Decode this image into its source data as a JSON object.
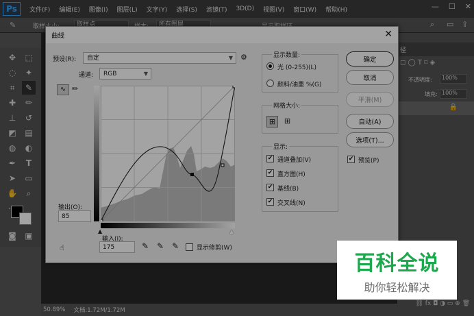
{
  "menubar": {
    "logo": "Ps",
    "items": [
      "文件(F)",
      "编辑(E)",
      "图像(I)",
      "图层(L)",
      "文字(Y)",
      "选择(S)",
      "滤镜(T)",
      "3D(D)",
      "视图(V)",
      "窗口(W)",
      "帮助(H)"
    ],
    "win_min": "—",
    "win_max": "☐",
    "win_close": "✕"
  },
  "optionsbar": {
    "sample_label": "取样大小:",
    "sample_value": "取样点",
    "layer_label": "样本:",
    "layer_value": "所有图层",
    "show_ring": "显示取样环"
  },
  "layers_panel": {
    "tab": "径",
    "opacity_label": "不透明度:",
    "opacity_value": "100%",
    "fill_label": "填充:",
    "fill_value": "100%"
  },
  "status": {
    "zoom": "50.89%",
    "doc": "文档:1.72M/1.72M"
  },
  "dialog": {
    "title": "曲线",
    "close": "✕",
    "preset_label": "预设(R):",
    "preset_value": "自定",
    "channel_label": "通道:",
    "channel_value": "RGB",
    "output_label": "输出(O):",
    "output_value": "85",
    "input_label": "输入(I):",
    "input_value": "175",
    "show_clipping": "显示修剪(W)",
    "display_amount": {
      "title": "显示数量:",
      "light": "光 (0-255)(L)",
      "pigment": "颜料/油墨 %(G)"
    },
    "grid_size": {
      "title": "网格大小:"
    },
    "show": {
      "title": "显示:",
      "channel_overlay": "通道叠加(V)",
      "histogram": "直方图(H)",
      "baseline": "基线(B)",
      "intersection": "交叉线(N)"
    },
    "buttons": {
      "ok": "确定",
      "cancel": "取消",
      "smooth": "平滑(M)",
      "auto": "自动(A)",
      "options": "选项(T)...",
      "preview": "预览(P)"
    }
  },
  "watermark": {
    "title": "百科全说",
    "subtitle": "助你轻松解决"
  }
}
